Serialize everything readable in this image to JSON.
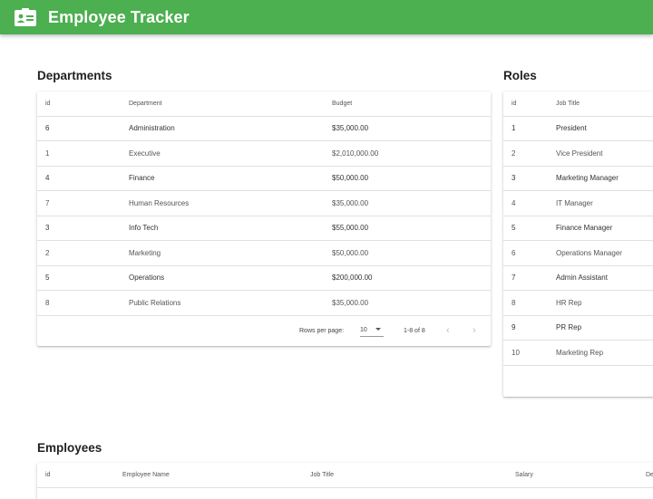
{
  "app": {
    "title": "Employee Tracker",
    "logo_icon": "badge-icon",
    "bar_color": "#4caf50"
  },
  "departments": {
    "title": "Departments",
    "columns": [
      "id",
      "Department",
      "Budget"
    ],
    "rows": [
      {
        "id": "6",
        "name": "Administration",
        "budget": "$35,000.00"
      },
      {
        "id": "1",
        "name": "Executive",
        "budget": "$2,010,000.00"
      },
      {
        "id": "4",
        "name": "Finance",
        "budget": "$50,000.00"
      },
      {
        "id": "7",
        "name": "Human Resources",
        "budget": "$35,000.00"
      },
      {
        "id": "3",
        "name": "Info Tech",
        "budget": "$55,000.00"
      },
      {
        "id": "2",
        "name": "Marketing",
        "budget": "$50,000.00"
      },
      {
        "id": "5",
        "name": "Operations",
        "budget": "$200,000.00"
      },
      {
        "id": "8",
        "name": "Public Relations",
        "budget": "$35,000.00"
      }
    ],
    "pagination": {
      "rows_per_page_label": "Rows per page:",
      "rows_per_page": "10",
      "range": "1-8 of 8",
      "prev_icon": "chevron-left-icon",
      "next_icon": "chevron-right-icon"
    }
  },
  "roles": {
    "title": "Roles",
    "columns": [
      "id",
      "Job Title"
    ],
    "rows": [
      {
        "id": "1",
        "title": "President"
      },
      {
        "id": "2",
        "title": "Vice President"
      },
      {
        "id": "3",
        "title": "Marketing Manager"
      },
      {
        "id": "4",
        "title": "IT Manager"
      },
      {
        "id": "5",
        "title": "Finance Manager"
      },
      {
        "id": "6",
        "title": "Operations Manager"
      },
      {
        "id": "7",
        "title": "Admin Assistant"
      },
      {
        "id": "8",
        "title": "HR Rep"
      },
      {
        "id": "9",
        "title": "PR Rep"
      },
      {
        "id": "10",
        "title": "Marketing Rep"
      }
    ]
  },
  "employees": {
    "title": "Employees",
    "columns": [
      "id",
      "Employee Name",
      "Job Title",
      "Salary",
      "De"
    ]
  }
}
